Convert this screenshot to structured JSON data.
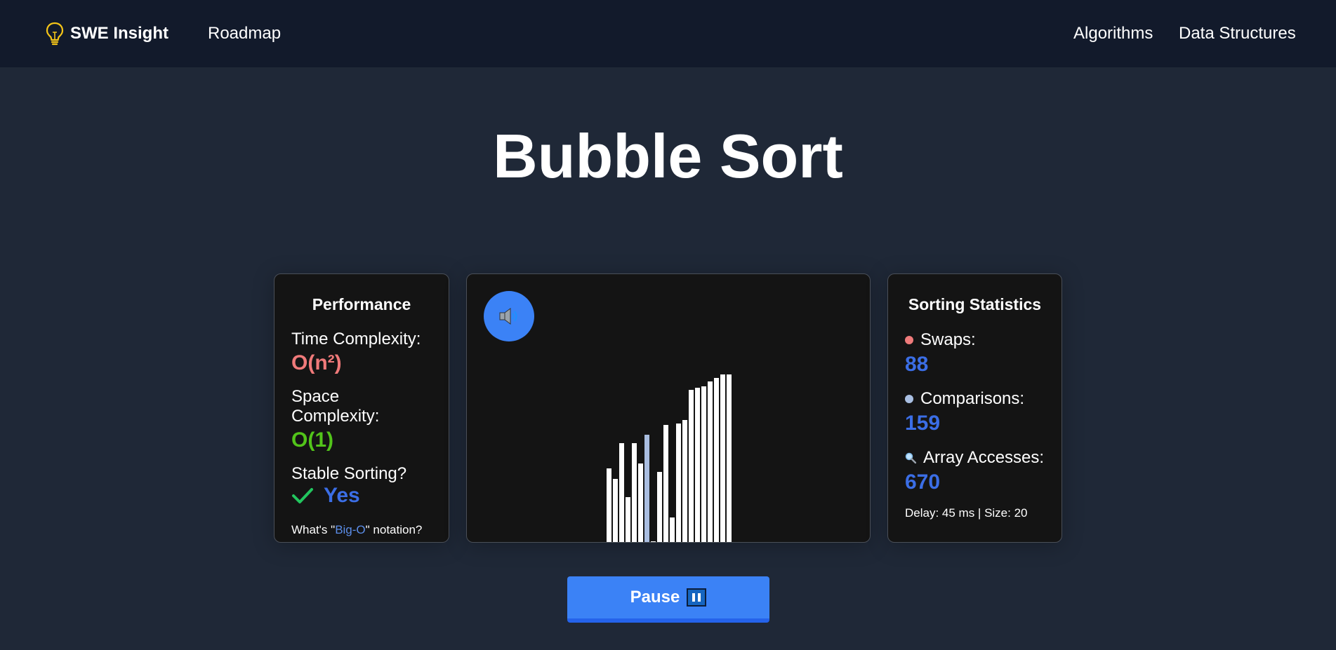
{
  "nav": {
    "brand": "SWE Insight",
    "roadmap": "Roadmap",
    "algorithms": "Algorithms",
    "data_structures": "Data Structures"
  },
  "page": {
    "title": "Bubble Sort"
  },
  "performance": {
    "title": "Performance",
    "time_label": "Time Complexity:",
    "time_value": "O(n²)",
    "space_label": "Space Complexity:",
    "space_value": "O(1)",
    "stable_label": "Stable Sorting?",
    "stable_value": "Yes",
    "note_prefix": "What's \"",
    "note_link": "Big-O",
    "note_suffix": "\" notation?"
  },
  "statistics": {
    "title": "Sorting Statistics",
    "swaps_label": "Swaps:",
    "swaps_value": "88",
    "comparisons_label": "Comparisons:",
    "comparisons_value": "159",
    "accesses_label": "Array Accesses:",
    "accesses_value": "670",
    "delay_line": "Delay: 45 ms | Size: 20"
  },
  "visualizer": {
    "sound_icon": "speaker-icon",
    "max_value": 100,
    "values": [
      44,
      38,
      59,
      27,
      59,
      47,
      64,
      1,
      42,
      70,
      15,
      71,
      73,
      91,
      92,
      93,
      96,
      98,
      100,
      100
    ],
    "active_indices": [
      6
    ],
    "active_color": "#a9bde0"
  },
  "controls": {
    "pause_label": "Pause"
  },
  "colors": {
    "accent": "#3b82f6",
    "time_complexity": "#f07a7a",
    "space_complexity": "#52c41a",
    "stat_value": "#3b6ee6",
    "navbar": "#121a2b",
    "background": "#1f2837"
  }
}
